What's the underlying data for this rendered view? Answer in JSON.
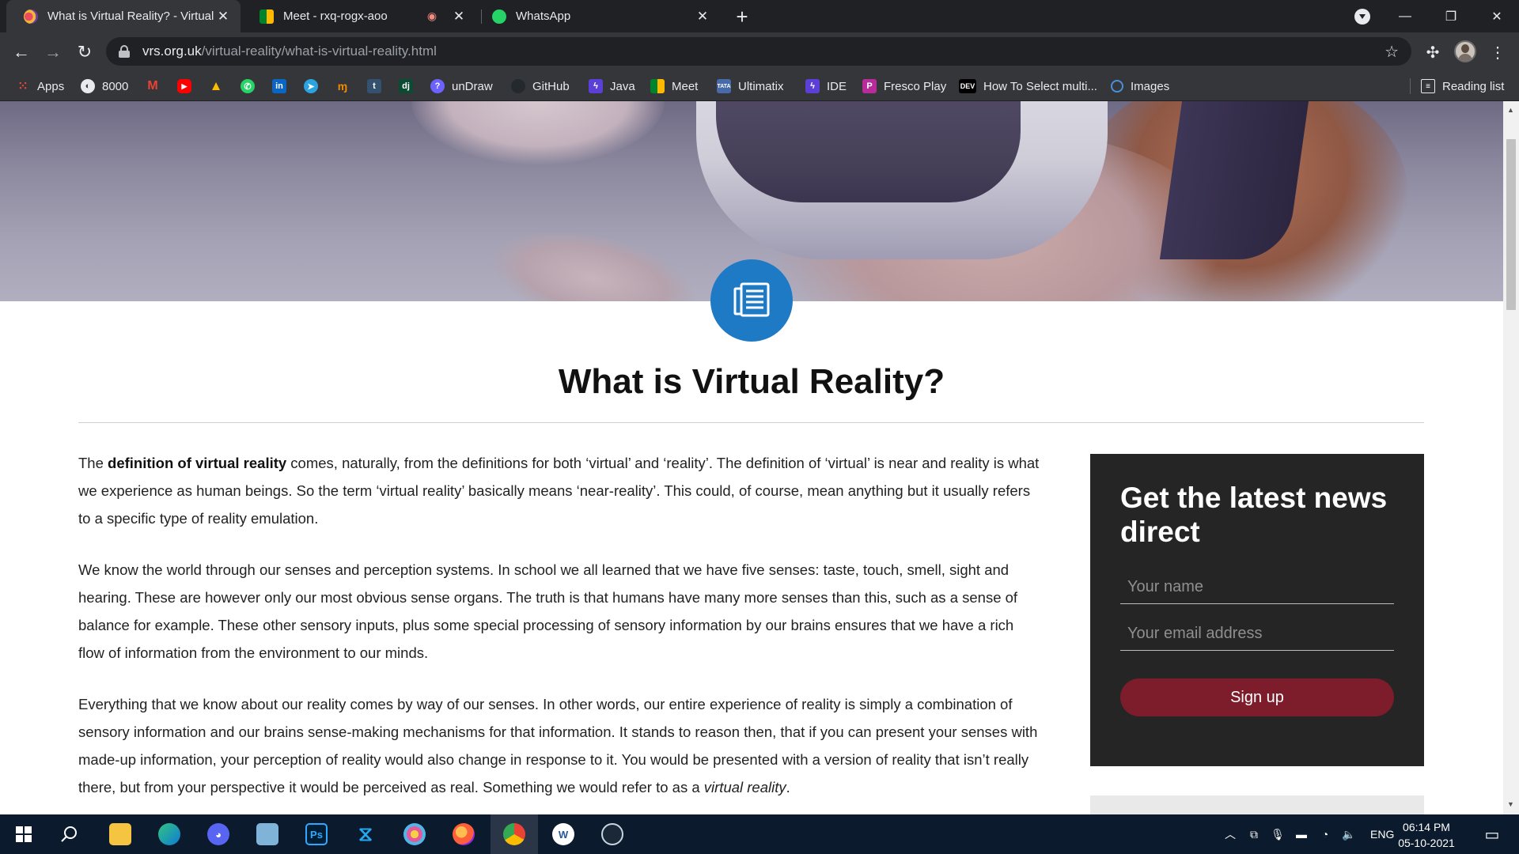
{
  "browser": {
    "tabs": [
      {
        "title": "What is Virtual Reality? - Virtual F",
        "active": true
      },
      {
        "title": "Meet - rxq-rogx-aoo",
        "active": false
      },
      {
        "title": "WhatsApp",
        "active": false
      }
    ],
    "url_host": "vrs.org.uk",
    "url_path": "/virtual-reality/what-is-virtual-reality.html",
    "bookmarks": [
      {
        "label": "Apps",
        "icon": "apps-grid-icon",
        "color": "#e8eaed"
      },
      {
        "label": "8000",
        "icon": "globe-icon",
        "color": "#e8eaed"
      },
      {
        "label": "",
        "icon": "gmail-icon",
        "color": "#ea4335"
      },
      {
        "label": "",
        "icon": "youtube-icon",
        "color": "#ff0000"
      },
      {
        "label": "",
        "icon": "drive-icon",
        "color": "#34a853"
      },
      {
        "label": "",
        "icon": "whatsapp-icon",
        "color": "#25d366"
      },
      {
        "label": "",
        "icon": "linkedin-icon",
        "color": "#0a66c2"
      },
      {
        "label": "",
        "icon": "telegram-icon",
        "color": "#2aa3df"
      },
      {
        "label": "",
        "icon": "naukri-icon",
        "color": "#f28b00"
      },
      {
        "label": "",
        "icon": "tumblr-icon",
        "color": "#34526f"
      },
      {
        "label": "",
        "icon": "django-icon",
        "color": "#0c4b33"
      },
      {
        "label": "unDraw",
        "icon": "undraw-icon",
        "color": "#6c63ff"
      },
      {
        "label": "GitHub",
        "icon": "github-icon",
        "color": "#24292e"
      },
      {
        "label": "Java",
        "icon": "bolt-icon",
        "color": "#5b3fd6"
      },
      {
        "label": "Meet",
        "icon": "meet-icon",
        "color": "#00897b"
      },
      {
        "label": "Ultimatix",
        "icon": "tata-icon",
        "color": "#486aa8"
      },
      {
        "label": "IDE",
        "icon": "bolt-icon",
        "color": "#5b3fd6"
      },
      {
        "label": "Fresco Play",
        "icon": "fresco-icon",
        "color": "#b72c9a"
      },
      {
        "label": "How To Select multi...",
        "icon": "dev-icon",
        "color": "#000000"
      },
      {
        "label": "Images",
        "icon": "images-icon",
        "color": "#4a90d9"
      }
    ],
    "reading_list": "Reading list"
  },
  "page": {
    "title": "What is Virtual Reality?",
    "paragraphs": {
      "p1_pre": "The ",
      "p1_bold": "definition of virtual reality",
      "p1_post": " comes, naturally, from the definitions for both ‘virtual’ and ‘reality’. The definition of ‘virtual’ is near and reality is what we experience as human beings. So the term ‘virtual reality’ basically means ‘near-reality’. This could, of course, mean anything but it usually refers to a specific type of reality emulation.",
      "p2": "We know the world through our senses and perception systems. In school we all learned that we have five senses: taste, touch, smell, sight and hearing. These are however only our most obvious sense organs. The truth is that humans have many more senses than this, such as a sense of balance for example. These other sensory inputs, plus some special processing of sensory information by our brains ensures that we have a rich flow of information from the environment to our minds.",
      "p3_pre": "Everything that we know about our reality comes by way of our senses. In other words, our entire experience of reality is simply a combination of sensory information and our brains sense-making mechanisms for that information. It stands to reason then, that if you can present your senses with made-up information, your perception of reality would also change in response to it. You would be presented with a version of reality that isn’t really there, but from your perspective it would be perceived as real. Something we would refer to as a ",
      "p3_italic": "virtual reality",
      "p3_post": "."
    },
    "newsletter": {
      "title": "Get the latest news direct",
      "name_placeholder": "Your name",
      "email_placeholder": "Your email address",
      "signup_label": "Sign up"
    },
    "accent_blue": "#1f7ac5",
    "signup_color": "#7d1d2c"
  },
  "taskbar": {
    "apps": [
      "start-icon",
      "search-icon",
      "file-explorer-icon",
      "edge-icon",
      "discord-icon",
      "notepad-icon",
      "photoshop-icon",
      "vscode-icon",
      "paint-icon",
      "firefox-icon",
      "chrome-icon",
      "word-icon",
      "steam-icon"
    ],
    "language": "ENG",
    "time": "06:14 PM",
    "date": "05-10-2021"
  }
}
